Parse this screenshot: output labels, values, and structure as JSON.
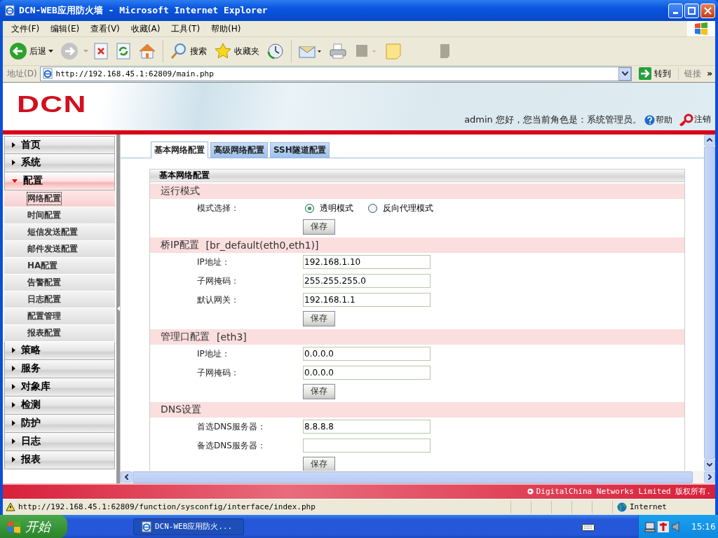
{
  "window": {
    "title": "DCN-WEB应用防火墙 - Microsoft Internet Explorer"
  },
  "menu": [
    "文件(F)",
    "编辑(E)",
    "查看(V)",
    "收藏(A)",
    "工具(T)",
    "帮助(H)"
  ],
  "toolbar": [
    {
      "kind": "back",
      "label": "后退"
    },
    {
      "kind": "forward"
    },
    {
      "kind": "stop"
    },
    {
      "kind": "refresh"
    },
    {
      "kind": "home"
    },
    {
      "kind": "search",
      "label": "搜索"
    },
    {
      "kind": "favorites",
      "label": "收藏夹"
    },
    {
      "kind": "history"
    },
    {
      "kind": "mail"
    },
    {
      "kind": "print"
    },
    {
      "kind": "edit"
    },
    {
      "kind": "note"
    },
    {
      "kind": "messenger"
    }
  ],
  "address": {
    "label": "地址(D)",
    "url": "http://192.168.45.1:62809/main.php",
    "go": "转到",
    "links": "链接",
    "more": "»"
  },
  "header": {
    "logo": "DCN",
    "greeting": "admin 您好，您当前角色是：系统管理员。",
    "help": "帮助",
    "logout": "注销"
  },
  "sidebar": {
    "items": [
      {
        "label": "首页",
        "expanded": false
      },
      {
        "label": "系统",
        "expanded": false
      },
      {
        "label": "配置",
        "expanded": true,
        "children": [
          {
            "label": "网络配置",
            "selected": true
          },
          {
            "label": "时间配置",
            "selected": false
          },
          {
            "label": "短信发送配置",
            "selected": false
          },
          {
            "label": "邮件发送配置",
            "selected": false
          },
          {
            "label": "HA配置",
            "selected": false
          },
          {
            "label": "告警配置",
            "selected": false
          },
          {
            "label": "日志配置",
            "selected": false
          },
          {
            "label": "配置管理",
            "selected": false
          },
          {
            "label": "报表配置",
            "selected": false
          }
        ]
      },
      {
        "label": "策略",
        "expanded": false
      },
      {
        "label": "服务",
        "expanded": false
      },
      {
        "label": "对象库",
        "expanded": false
      },
      {
        "label": "检测",
        "expanded": false
      },
      {
        "label": "防护",
        "expanded": false
      },
      {
        "label": "日志",
        "expanded": false
      },
      {
        "label": "报表",
        "expanded": false
      }
    ]
  },
  "tabs": [
    {
      "label": "基本网络配置",
      "selected": true
    },
    {
      "label": "高级网络配置",
      "selected": false
    },
    {
      "label": "SSH隧道配置",
      "selected": false
    }
  ],
  "panel": {
    "title": "基本网络配置",
    "sections": [
      {
        "title": "运行模式",
        "rows": [
          {
            "kind": "radio",
            "label": "模式选择：",
            "options": [
              {
                "label": "透明模式",
                "selected": true
              },
              {
                "label": "反向代理模式",
                "selected": false
              }
            ]
          }
        ],
        "save": "保存"
      },
      {
        "title": "桥IP配置",
        "interface": "[br_default(eth0,eth1)]",
        "rows": [
          {
            "kind": "input",
            "label": "IP地址：",
            "value": "192.168.1.10"
          },
          {
            "kind": "input",
            "label": "子网掩码：",
            "value": "255.255.255.0"
          },
          {
            "kind": "input",
            "label": "默认网关：",
            "value": "192.168.1.1"
          }
        ],
        "save": "保存"
      },
      {
        "title": "管理口配置",
        "interface": "[eth3]",
        "rows": [
          {
            "kind": "input",
            "label": "IP地址：",
            "value": "0.0.0.0"
          },
          {
            "kind": "input",
            "label": "子网掩码：",
            "value": "0.0.0.0"
          }
        ],
        "save": "保存"
      },
      {
        "title": "DNS设置",
        "rows": [
          {
            "kind": "input",
            "label": "首选DNS服务器：",
            "value": "8.8.8.8"
          },
          {
            "kind": "input",
            "label": "备选DNS服务器："
          }
        ],
        "save": "保存"
      }
    ]
  },
  "footer": {
    "copyright": "DigitalChina Networks Limited 版权所有."
  },
  "status_bar": {
    "url": "http://192.168.45.1:62809/function/sysconfig/interface/index.php",
    "zone": "Internet"
  },
  "taskbar": {
    "start": "开始",
    "task": "DCN-WEB应用防火...",
    "clock": "15:16"
  }
}
